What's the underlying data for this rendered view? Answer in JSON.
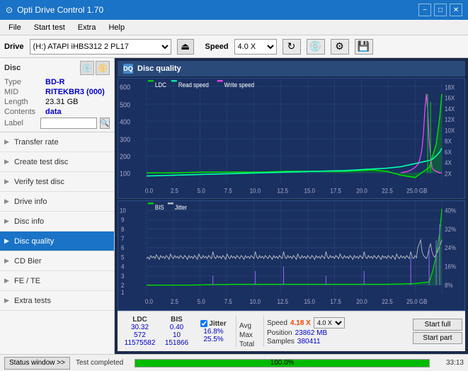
{
  "titlebar": {
    "title": "Opti Drive Control 1.70",
    "icon": "⊙",
    "minimize": "−",
    "maximize": "□",
    "close": "✕"
  },
  "menubar": {
    "items": [
      "File",
      "Start test",
      "Extra",
      "Help"
    ]
  },
  "drivebar": {
    "drive_label": "Drive",
    "drive_value": "(H:) ATAPI iHBS312  2 PL17",
    "speed_label": "Speed",
    "speed_value": "4.0 X"
  },
  "disc": {
    "section_label": "Disc",
    "type_key": "Type",
    "type_val": "BD-R",
    "mid_key": "MID",
    "mid_val": "RITEKBR3 (000)",
    "length_key": "Length",
    "length_val": "23.31 GB",
    "contents_key": "Contents",
    "contents_val": "data",
    "label_key": "Label",
    "label_placeholder": ""
  },
  "nav": {
    "items": [
      {
        "id": "transfer-rate",
        "label": "Transfer rate",
        "active": false
      },
      {
        "id": "create-test-disc",
        "label": "Create test disc",
        "active": false
      },
      {
        "id": "verify-test-disc",
        "label": "Verify test disc",
        "active": false
      },
      {
        "id": "drive-info",
        "label": "Drive info",
        "active": false
      },
      {
        "id": "disc-info",
        "label": "Disc info",
        "active": false
      },
      {
        "id": "disc-quality",
        "label": "Disc quality",
        "active": true
      },
      {
        "id": "cd-bier",
        "label": "CD Bier",
        "active": false
      },
      {
        "id": "fe-te",
        "label": "FE / TE",
        "active": false
      },
      {
        "id": "extra-tests",
        "label": "Extra tests",
        "active": false
      }
    ]
  },
  "chart": {
    "title": "Disc quality",
    "legend": {
      "ldc": "LDC",
      "read_speed": "Read speed",
      "write_speed": "Write speed"
    },
    "legend2": {
      "bis": "BIS",
      "jitter": "Jitter"
    },
    "upper": {
      "y_max": 600,
      "y_labels": [
        "600",
        "500",
        "400",
        "300",
        "200",
        "100"
      ],
      "y_right": [
        "18X",
        "16X",
        "14X",
        "12X",
        "10X",
        "8X",
        "6X",
        "4X",
        "2X"
      ],
      "x_labels": [
        "0.0",
        "2.5",
        "5.0",
        "7.5",
        "10.0",
        "12.5",
        "15.0",
        "17.5",
        "20.0",
        "22.5",
        "25.0 GB"
      ]
    },
    "lower": {
      "y_max": 10,
      "y_labels": [
        "10",
        "9",
        "8",
        "7",
        "6",
        "5",
        "4",
        "3",
        "2",
        "1"
      ],
      "y_right": [
        "40%",
        "32%",
        "24%",
        "16%",
        "8%"
      ],
      "x_labels": [
        "0.0",
        "2.5",
        "5.0",
        "7.5",
        "10.0",
        "12.5",
        "15.0",
        "17.5",
        "20.0",
        "22.5",
        "25.0 GB"
      ]
    }
  },
  "stats": {
    "cols": [
      {
        "header": "LDC",
        "avg": "30.32",
        "max": "572",
        "total": "11575582"
      },
      {
        "header": "BIS",
        "avg": "0.40",
        "max": "10",
        "total": "151866"
      }
    ],
    "jitter": {
      "label": "Jitter",
      "avg": "16.8%",
      "max": "25.5%",
      "total": ""
    },
    "speed": {
      "label": "Speed",
      "value": "4.18 X",
      "select": "4.0 X"
    },
    "position": {
      "label": "Position",
      "value": "23862 MB"
    },
    "samples": {
      "label": "Samples",
      "value": "380411"
    },
    "row_labels": [
      "Avg",
      "Max",
      "Total"
    ],
    "start_full": "Start full",
    "start_part": "Start part"
  },
  "statusbar": {
    "status_window": "Status window >>",
    "status_text": "Test completed",
    "progress": 100,
    "progress_label": "100.0%",
    "time": "33:13"
  },
  "colors": {
    "ldc_line": "#00dd00",
    "read_speed_line": "#00ff88",
    "write_speed_line": "#ff00ff",
    "bis_line": "#9966ff",
    "jitter_line": "#dddddd",
    "bg_chart": "#1a3060",
    "grid": "#2a4a80",
    "accent": "#1a73c6",
    "speed_val": "#ff4400"
  }
}
